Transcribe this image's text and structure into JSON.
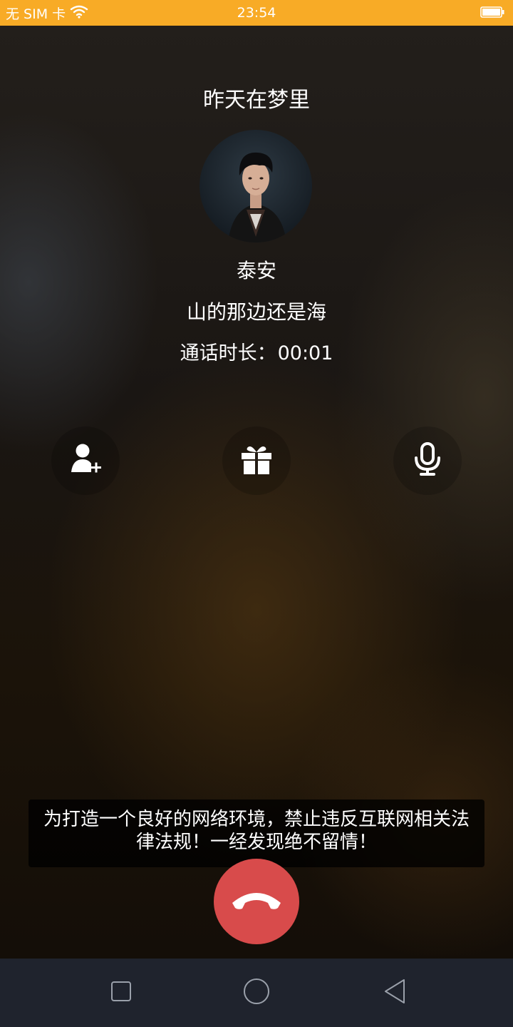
{
  "status_bar": {
    "carrier": "无 SIM 卡",
    "time": "23:54",
    "icons": [
      "wifi-icon",
      "battery-icon"
    ],
    "color": "#f8ab26"
  },
  "call": {
    "song_title": "昨天在梦里",
    "caller_name": "泰安",
    "caller_subtitle": "山的那边还是海",
    "duration_label": "通话时长：",
    "duration_value": "00:01"
  },
  "actions": [
    {
      "icon": "add-user-icon"
    },
    {
      "icon": "gift-icon"
    },
    {
      "icon": "microphone-icon"
    }
  ],
  "notice": {
    "text": "为打造一个良好的网络环境，禁止违反互联网相关法律法规！一经发现绝不留情！"
  },
  "hangup": {
    "icon": "phone-hangup-icon",
    "color": "#d84b4b"
  },
  "nav_bar": {
    "buttons": [
      "square-recent-icon",
      "circle-home-icon",
      "triangle-back-icon"
    ]
  }
}
